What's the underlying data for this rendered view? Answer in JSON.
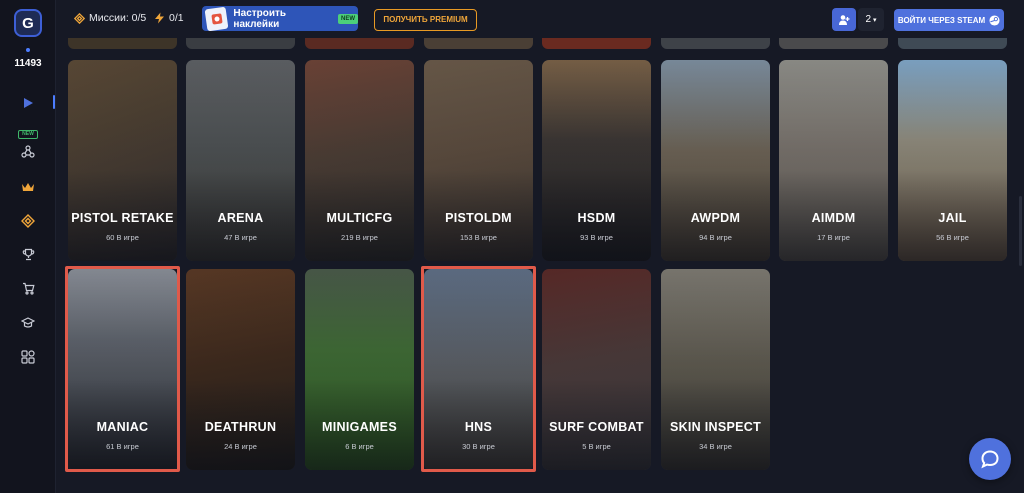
{
  "sidebar": {
    "logo_text": "G",
    "online_count": "11493",
    "new_badge": "NEW",
    "items": [
      {
        "icon": "play-icon",
        "active": true
      },
      {
        "icon": "molecule-icon"
      },
      {
        "icon": "crown-icon"
      },
      {
        "icon": "diamond-target-icon"
      },
      {
        "icon": "trophy-icon"
      },
      {
        "icon": "cart-icon"
      },
      {
        "icon": "graduation-cap-icon"
      },
      {
        "icon": "grid-apps-icon"
      }
    ]
  },
  "topbar": {
    "missions_label": "Миссии: 0/5",
    "bonus_label": "0/1",
    "sticker_label": "Настроить наклейки",
    "sticker_new": "NEW",
    "premium_label": "ПОЛУЧИТЬ PREMIUM",
    "friends_count": "2",
    "steam_label": "ВОЙТИ ЧЕРЕЗ STEAM"
  },
  "modes": [
    {
      "name": "PISTOL RETAKE",
      "online": "60 В игре",
      "highlighted": false
    },
    {
      "name": "ARENA",
      "online": "47 В игре",
      "highlighted": false
    },
    {
      "name": "MULTICFG",
      "online": "219 В игре",
      "highlighted": false
    },
    {
      "name": "PISTOLDM",
      "online": "153 В игре",
      "highlighted": false
    },
    {
      "name": "HSDM",
      "online": "93 В игре",
      "highlighted": false
    },
    {
      "name": "AWPDM",
      "online": "94 В игре",
      "highlighted": false
    },
    {
      "name": "AIMDM",
      "online": "17 В игре",
      "highlighted": false
    },
    {
      "name": "JAIL",
      "online": "56 В игре",
      "highlighted": false
    },
    {
      "name": "MANIAC",
      "online": "61 В игре",
      "highlighted": true
    },
    {
      "name": "DEATHRUN",
      "online": "24 В игре",
      "highlighted": false
    },
    {
      "name": "MINIGAMES",
      "online": "6 В игре",
      "highlighted": false
    },
    {
      "name": "HNS",
      "online": "30 В игре",
      "highlighted": true
    },
    {
      "name": "SURF COMBAT",
      "online": "5 В игре",
      "highlighted": false
    },
    {
      "name": "SKIN INSPECT",
      "online": "34 В игре",
      "highlighted": false
    }
  ],
  "colors": {
    "accent": "#4f71dd",
    "premium": "#f0a63a",
    "highlight": "#e05a4a",
    "new_badge": "#4ccf7a"
  }
}
